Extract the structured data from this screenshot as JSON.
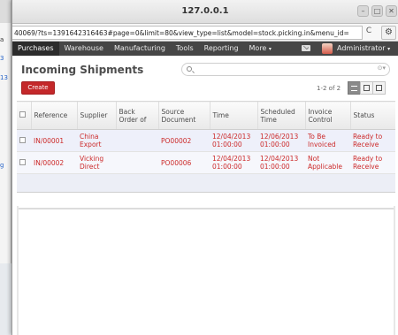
{
  "background_window": {
    "snippet_1": "a",
    "snippet_2": "3",
    "snippet_3": "13",
    "snippet_4": "g"
  },
  "browser": {
    "title": "127.0.0.1",
    "url": "40069/?ts=1391642316463#page=0&limit=80&view_type=list&model=stock.picking.in&menu_id=",
    "reload_icon": "C",
    "settings_icon": "⚙"
  },
  "menu": {
    "items": [
      {
        "label": "Purchases",
        "active": true
      },
      {
        "label": "Warehouse"
      },
      {
        "label": "Manufacturing"
      },
      {
        "label": "Tools"
      },
      {
        "label": "Reporting"
      },
      {
        "label": "More"
      }
    ],
    "more_caret": "▾",
    "user": "Administrator",
    "user_caret": "▾"
  },
  "page": {
    "title": "Incoming Shipments",
    "search_placeholder": "",
    "search_options_icon": "⊙▾",
    "create_label": "Create",
    "pager": "1-2 of 2"
  },
  "table": {
    "headers": [
      "Reference",
      "Supplier",
      "Back Order of",
      "Source Document",
      "Time",
      "Scheduled Time",
      "Invoice Control",
      "Status"
    ],
    "rows": [
      {
        "reference": "IN/00001",
        "supplier": "China Export",
        "back_order_of": "",
        "source_document": "PO00002",
        "time": "12/04/2013 01:00:00",
        "scheduled_time": "12/06/2013 01:00:00",
        "invoice_control": "To Be Invoiced",
        "status": "Ready to Receive"
      },
      {
        "reference": "IN/00002",
        "supplier": "Vicking Direct",
        "back_order_of": "",
        "source_document": "PO00006",
        "time": "12/04/2013 01:00:00",
        "scheduled_time": "12/04/2013 01:00:00",
        "invoice_control": "Not Applicable",
        "status": "Ready to Receive"
      }
    ]
  },
  "colors": {
    "accent_red": "#c4282a",
    "row_text": "#cc2a2a",
    "menu_bg": "#464646"
  }
}
